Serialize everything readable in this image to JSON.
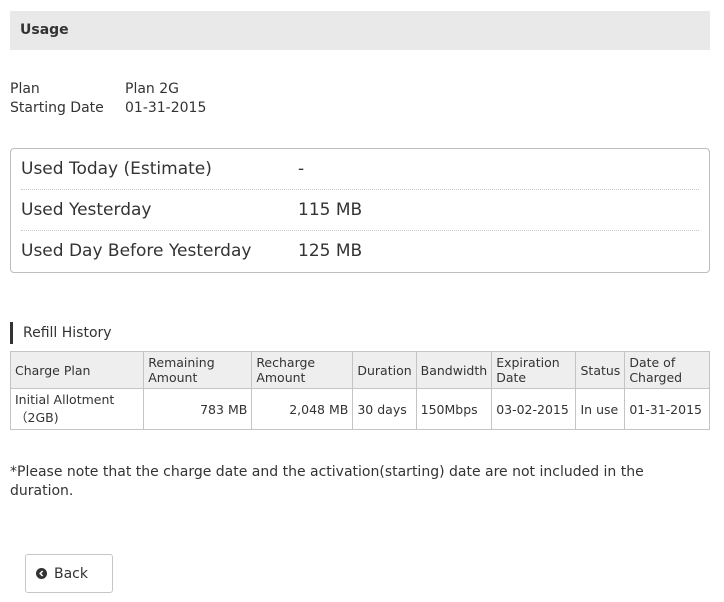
{
  "header": {
    "title": "Usage"
  },
  "plan": {
    "plan_label": "Plan",
    "plan_value": "Plan 2G",
    "start_label": "Starting Date",
    "start_value": "01-31-2015"
  },
  "usage": [
    {
      "label": "Used Today (Estimate)",
      "value": "-"
    },
    {
      "label": "Used Yesterday",
      "value": "115 MB"
    },
    {
      "label": "Used Day Before Yesterday",
      "value": "125 MB"
    }
  ],
  "refill": {
    "title": "Refill History",
    "headers": [
      "Charge Plan",
      "Remaining Amount",
      "Recharge Amount",
      "Duration",
      "Bandwidth",
      "Expiration Date",
      "Status",
      "Date of Charged"
    ],
    "rows": [
      [
        "Initial Allotment（2GB)",
        "783 MB",
        "2,048 MB",
        "30 days",
        "150Mbps",
        "03-02-2015",
        "In use",
        "01-31-2015"
      ]
    ]
  },
  "note": "*Please note that the charge date and the activation(starting) date are not included in the duration.",
  "back": {
    "label": "Back",
    "icon": "chevron-left-circle-icon"
  }
}
